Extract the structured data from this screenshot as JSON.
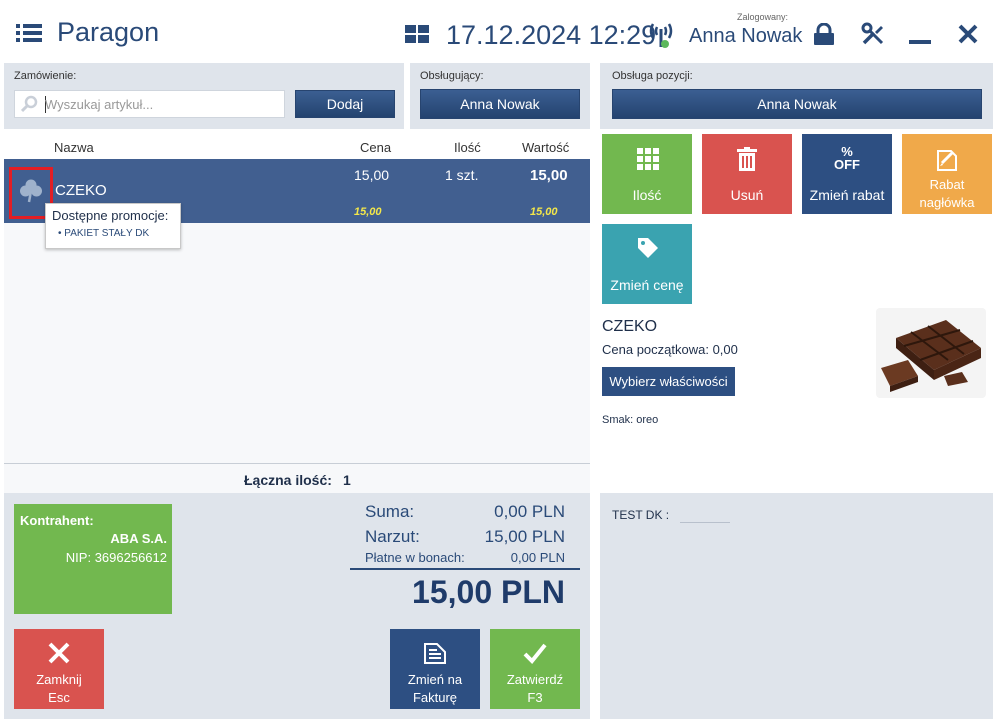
{
  "header": {
    "title": "Paragon",
    "datetime": "17.12.2024 12:29",
    "logged_label": "Zalogowany:",
    "user": "Anna Nowak"
  },
  "order": {
    "label": "Zamówienie:",
    "search_placeholder": "Wyszukaj artykuł...",
    "add_label": "Dodaj"
  },
  "serving": {
    "label": "Obsługujący:",
    "value": "Anna Nowak"
  },
  "position_service": {
    "label": "Obsługa pozycji:",
    "value": "Anna Nowak"
  },
  "table": {
    "columns": [
      "Nazwa",
      "Cena",
      "Ilość",
      "Wartość"
    ],
    "rows": [
      {
        "name": "CZEKO",
        "price": "15,00",
        "qty": "1 szt.",
        "value": "15,00",
        "promo_price": "15,00",
        "promo_value": "15,00"
      }
    ],
    "tooltip_title": "Dostępne promocje:",
    "tooltip_item": "• PAKIET STAŁY DK",
    "total_qty_label": "Łączna ilość:",
    "total_qty": "1"
  },
  "tiles": {
    "qty": "Ilość",
    "delete": "Usuń",
    "discount": "Zmień rabat",
    "discount_badge_top": "%",
    "discount_badge_bottom": "OFF",
    "header_discount_1": "Rabat",
    "header_discount_2": "nagłówka",
    "change_price": "Zmień cenę"
  },
  "product": {
    "name": "CZEKO",
    "initial_price_label": "Cena początkowa: 0,00",
    "choose_props": "Wybierz właściwości",
    "flavor": "Smak: oreo"
  },
  "customer": {
    "label": "Kontrahent:",
    "name": "ABA S.A.",
    "nip": "NIP: 3696256612"
  },
  "summary": {
    "sum_label": "Suma:",
    "sum_value": "0,00 PLN",
    "markup_label": "Narzut:",
    "markup_value": "15,00 PLN",
    "vouchers_label": "Płatne w bonach:",
    "vouchers_value": "0,00 PLN",
    "total": "15,00 PLN"
  },
  "buttons": {
    "close_1": "Zamknij",
    "close_2": "Esc",
    "invoice_1": "Zmień na",
    "invoice_2": "Fakturę",
    "confirm_1": "Zatwierdź",
    "confirm_2": "F3"
  },
  "right_bottom": {
    "label": "TEST DK :"
  },
  "colors": {
    "accent": "#2d4f82",
    "green": "#72b84f",
    "red": "#d9534f",
    "orange": "#f0a94a",
    "teal": "#3aa3b0"
  }
}
